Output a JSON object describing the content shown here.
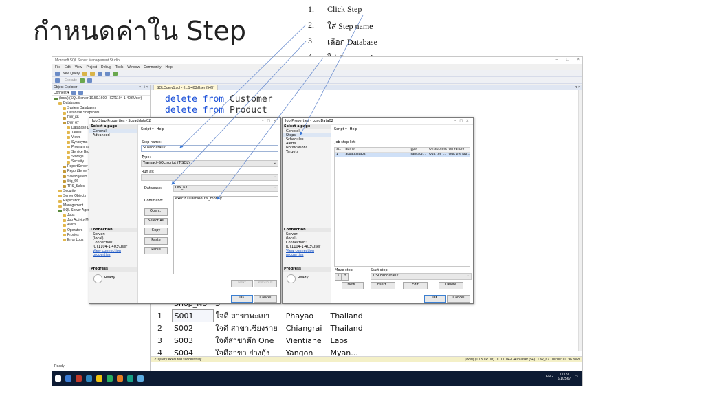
{
  "slide": {
    "title": "กำหนดค่าใน Step",
    "steps": [
      {
        "num": "1.",
        "text": "Click Step"
      },
      {
        "num": "2.",
        "text": "ใส่ Step name"
      },
      {
        "num": "3.",
        "text": "เลือก Database"
      },
      {
        "num": "4.",
        "text": "ใส่ Command"
      }
    ]
  },
  "ssms": {
    "window_title": "Microsoft SQL Server Management Studio",
    "window_controls": [
      "–",
      "□",
      "×"
    ],
    "menu": [
      "File",
      "Edit",
      "View",
      "Project",
      "Debug",
      "Tools",
      "Window",
      "Community",
      "Help"
    ],
    "toolbar_new_query": "New Query",
    "toolbar_execute": "! Execute",
    "object_explorer": {
      "title": "Object Explorer",
      "pin": "▾ ⊣ ×",
      "connect": "Connect ▾",
      "tree": [
        {
          "text": "(local) (SQL Server 10.50.1600 - ICT1104-1-403\\User)",
          "indent": 0,
          "icon": "srv"
        },
        {
          "text": "Databases",
          "indent": 1,
          "icon": "folder"
        },
        {
          "text": "System Databases",
          "indent": 2,
          "icon": "folder"
        },
        {
          "text": "Database Snapshots",
          "indent": 2,
          "icon": "folder"
        },
        {
          "text": "DW_66",
          "indent": 2,
          "icon": "db"
        },
        {
          "text": "DW_67",
          "indent": 2,
          "icon": "db"
        },
        {
          "text": "Database Diagrams",
          "indent": 3,
          "icon": "folder"
        },
        {
          "text": "Tables",
          "indent": 3,
          "icon": "folder"
        },
        {
          "text": "Views",
          "indent": 3,
          "icon": "folder"
        },
        {
          "text": "Synonyms",
          "indent": 3,
          "icon": "folder"
        },
        {
          "text": "Programmability",
          "indent": 3,
          "icon": "folder"
        },
        {
          "text": "Service Broker",
          "indent": 3,
          "icon": "folder"
        },
        {
          "text": "Storage",
          "indent": 3,
          "icon": "folder"
        },
        {
          "text": "Security",
          "indent": 3,
          "icon": "folder"
        },
        {
          "text": "ReportServer",
          "indent": 2,
          "icon": "db"
        },
        {
          "text": "ReportServerTempDB",
          "indent": 2,
          "icon": "db"
        },
        {
          "text": "SalesSystem",
          "indent": 2,
          "icon": "db"
        },
        {
          "text": "Stg_66",
          "indent": 2,
          "icon": "db"
        },
        {
          "text": "TPS_Sales",
          "indent": 2,
          "icon": "db"
        },
        {
          "text": "Security",
          "indent": 1,
          "icon": "folder"
        },
        {
          "text": "Server Objects",
          "indent": 1,
          "icon": "folder"
        },
        {
          "text": "Replication",
          "indent": 1,
          "icon": "folder"
        },
        {
          "text": "Management",
          "indent": 1,
          "icon": "folder"
        },
        {
          "text": "SQL Server Agent",
          "indent": 1,
          "icon": "srv"
        },
        {
          "text": "Jobs",
          "indent": 2,
          "icon": "folder"
        },
        {
          "text": "Job Activity Monitor",
          "indent": 2,
          "icon": "folder"
        },
        {
          "text": "Alerts",
          "indent": 2,
          "icon": "folder"
        },
        {
          "text": "Operators",
          "indent": 2,
          "icon": "folder"
        },
        {
          "text": "Proxies",
          "indent": 2,
          "icon": "folder"
        },
        {
          "text": "Error Logs",
          "indent": 2,
          "icon": "folder"
        }
      ]
    },
    "editor": {
      "tab": "SQLQuery1.sql - (l...1-403\\User (54))*",
      "lines": [
        {
          "kw1": "delete",
          "kw2": "from",
          "obj": "Customer"
        },
        {
          "kw1": "delete",
          "kw2": "from",
          "obj": "Product"
        }
      ]
    },
    "results": {
      "header": [
        "",
        "Shop_No",
        "S",
        "",
        ""
      ],
      "rows": [
        [
          "1",
          "S001",
          "ใจดี สาขาพะเยา",
          "Phayao",
          "Thailand"
        ],
        [
          "2",
          "S002",
          "ใจดี สาขาเชียงราย",
          "Chiangrai",
          "Thailand"
        ],
        [
          "3",
          "S003",
          "ใจดีสาขาตึก One",
          "Vientiane",
          "Laos"
        ],
        [
          "4",
          "S004",
          "ใจดีสาขา ย่างกุ้ง",
          "Yangon",
          "Myan..."
        ]
      ]
    },
    "status": {
      "message": "Query executed successfully.",
      "server": "(local) (10.50 RTM)",
      "user": "ICT1104-1-403\\User (54)",
      "db": "DW_67",
      "time": "00:00:00",
      "rows": "96 rows"
    },
    "ready": "Ready",
    "tray": {
      "lang": "ENG",
      "time": "17:09",
      "date": "5/1/2567"
    }
  },
  "job_step": {
    "title": "Job Step Properties - SLoaddata02",
    "select_page": "Select a page",
    "pages": [
      "General",
      "Advanced"
    ],
    "toolbar_script": "Script ▾",
    "toolbar_help": "Help",
    "step_name_label": "Step name:",
    "step_name_value": "SLoaddata02",
    "type_label": "Type:",
    "type_value": "Transact-SQL script (T-SQL)",
    "run_as_label": "Run as:",
    "database_label": "Database:",
    "database_value": "DW_67",
    "command_label": "Command:",
    "command_value": "exec ETLDataToDW_money",
    "side_buttons": [
      "Open...",
      "Select All",
      "Copy",
      "Paste",
      "Parse"
    ],
    "connection_header": "Connection",
    "server_label": "Server:",
    "server_value": "(local)",
    "connection_label": "Connection:",
    "connection_value": "ICT1104-1-403\\User",
    "view_conn": "View connection properties",
    "progress_header": "Progress",
    "progress_value": "Ready",
    "btn_next": "Next",
    "btn_previous": "Previous",
    "btn_ok": "OK",
    "btn_cancel": "Cancel"
  },
  "job_props": {
    "title": "Job Properties - LoadData02",
    "select_page": "Select a page",
    "pages": [
      "General",
      "Steps",
      "Schedules",
      "Alerts",
      "Notifications",
      "Targets"
    ],
    "toolbar_script": "Script ▾",
    "toolbar_help": "Help",
    "list_label": "Job step list:",
    "columns": [
      "St...",
      "Name",
      "Type",
      "On Success",
      "On Failure"
    ],
    "rows": [
      [
        "1",
        "SLoaddata02",
        "Transact-...",
        "Quit the j...",
        "Quit the job..."
      ]
    ],
    "connection_header": "Connection",
    "server_label": "Server:",
    "server_value": "(local)",
    "connection_label": "Connection:",
    "connection_value": "ICT1104-1-403\\User",
    "view_conn": "View connection properties",
    "progress_header": "Progress",
    "progress_value": "Ready",
    "move_step": "Move step:",
    "start_step": "Start step:",
    "start_step_value": "1:SLoaddata02",
    "btn_new": "New...",
    "btn_insert": "Insert...",
    "btn_edit": "Edit",
    "btn_delete": "Delete",
    "btn_ok": "OK",
    "btn_cancel": "Cancel"
  },
  "colors": {
    "accent": "#3a78d6",
    "callout_line": "#6d8fd0",
    "taskbar": "#0d1b33"
  }
}
